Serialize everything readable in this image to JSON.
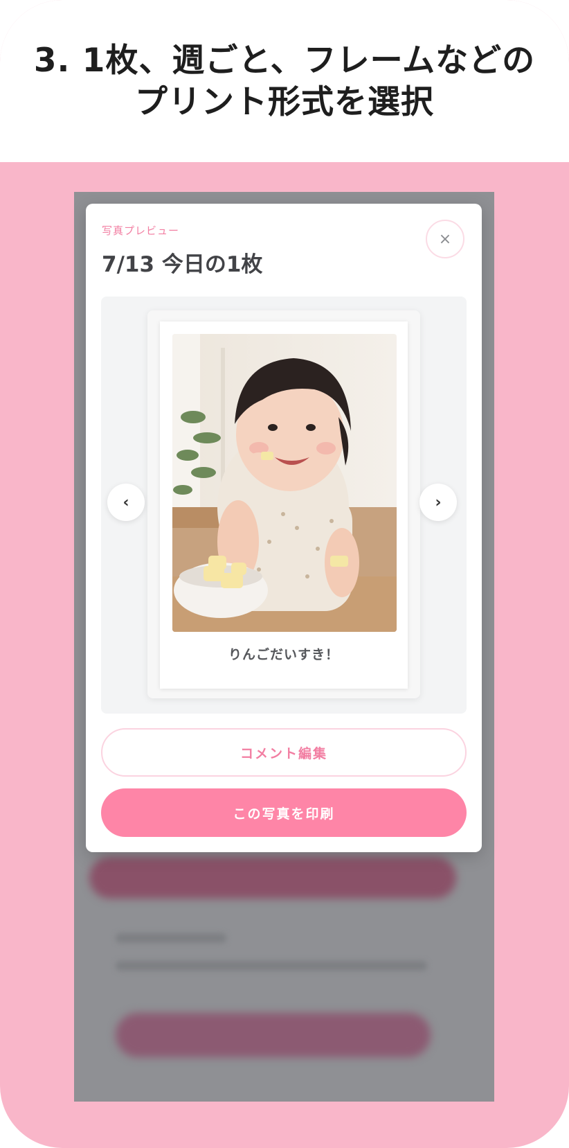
{
  "header": {
    "line1": "3. 1枚、週ごと、フレームなどの",
    "line2": "プリント形式を選択"
  },
  "modal": {
    "eyebrow": "写真プレビュー",
    "title": "7/13 今日の1枚",
    "close_icon": "×",
    "prev_icon": "‹",
    "next_icon": "›",
    "caption": "りんごだいすき！",
    "edit_comment_label": "コメント編集",
    "print_label": "この写真を印刷"
  },
  "colors": {
    "frame_pink": "#f9b6c9",
    "accent_pink": "#fe85a7",
    "eyebrow_pink": "#f27ea2",
    "overlay_gray": "#8f9094"
  }
}
